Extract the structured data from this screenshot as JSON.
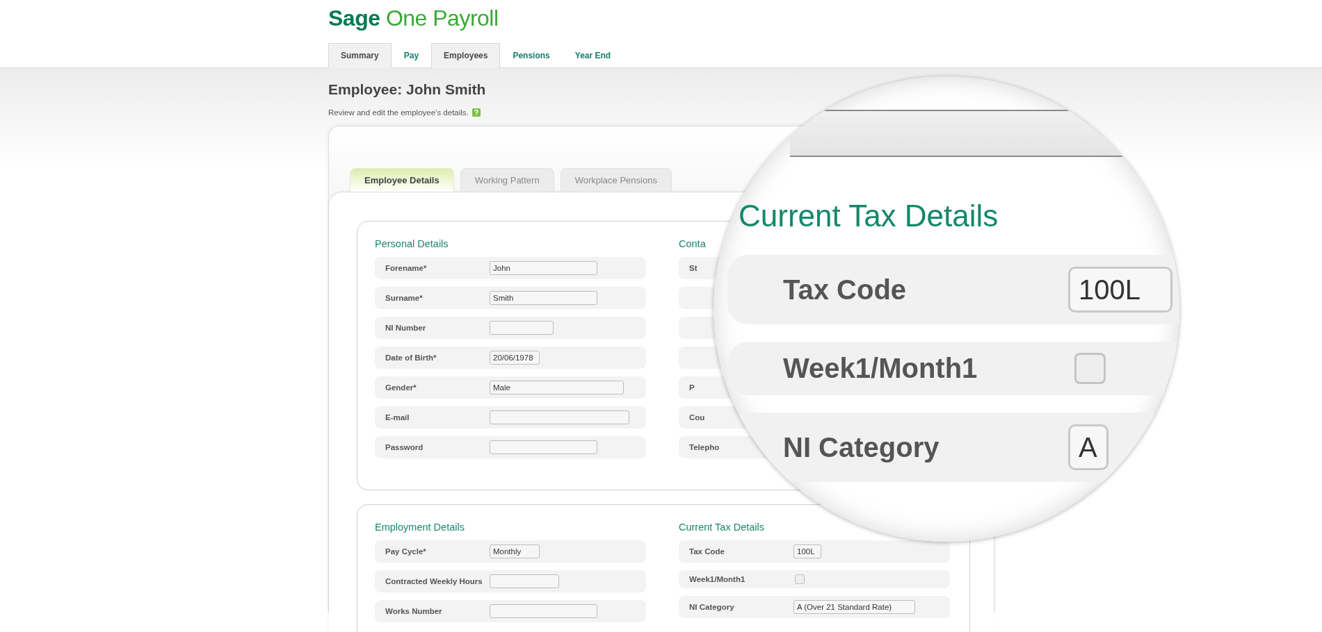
{
  "logo": {
    "brand": "Sage",
    "product": "One Payroll"
  },
  "nav": [
    {
      "label": "Summary",
      "selected": true
    },
    {
      "label": "Pay",
      "selected": false
    },
    {
      "label": "Employees",
      "selected": true
    },
    {
      "label": "Pensions",
      "selected": false
    },
    {
      "label": "Year End",
      "selected": false
    }
  ],
  "page": {
    "title": "Employee: John Smith",
    "subtitle": "Review and edit the employee’s details."
  },
  "tabs": [
    {
      "label": "Employee Details",
      "selected": true
    },
    {
      "label": "Working Pattern",
      "selected": false
    },
    {
      "label": "Workplace Pensions",
      "selected": false
    }
  ],
  "sections": [
    {
      "columns": [
        {
          "heading": "Personal Details",
          "rows": [
            {
              "kind": "text",
              "label": "Forename*",
              "value": "John"
            },
            {
              "kind": "text",
              "label": "Surname*",
              "value": "Smith"
            },
            {
              "kind": "text",
              "label": "NI Number"
            },
            {
              "kind": "text",
              "label": "Date of Birth*",
              "value": "20/06/1978"
            },
            {
              "kind": "text",
              "label": "Gender*",
              "value": "Male"
            },
            {
              "kind": "text",
              "label": "E-mail"
            },
            {
              "kind": "text",
              "label": "Password"
            }
          ]
        },
        {
          "heading": "Conta",
          "rows": [
            {
              "kind": "covered",
              "label": "St"
            },
            {
              "kind": "covered"
            },
            {
              "kind": "covered"
            },
            {
              "kind": "covered"
            },
            {
              "kind": "covered",
              "label": "P"
            },
            {
              "kind": "covered",
              "label": "Cou"
            },
            {
              "kind": "covered",
              "label": "Telepho"
            }
          ]
        }
      ]
    },
    {
      "columns": [
        {
          "heading": "Employment Details",
          "rows": [
            {
              "kind": "text",
              "label": "Pay Cycle*",
              "value": "Monthly"
            },
            {
              "kind": "text",
              "label": "Contracted Weekly Hours"
            },
            {
              "kind": "text",
              "label": "Works Number"
            }
          ]
        },
        {
          "heading": "Current Tax Details",
          "rows": [
            {
              "kind": "text",
              "label": "Tax Code",
              "value": "100L"
            },
            {
              "kind": "checkbox",
              "label": "Week1/Month1",
              "checked": false
            },
            {
              "kind": "text",
              "label": "NI Category",
              "value": "A (Over 21 Standard Rate)"
            }
          ]
        }
      ]
    }
  ],
  "magnifier": {
    "heading": "Current Tax Details",
    "rows": [
      {
        "kind": "text",
        "label": "Tax Code",
        "value": "100L"
      },
      {
        "kind": "checkbox",
        "label": "Week1/Month1",
        "checked": false
      },
      {
        "kind": "text",
        "label": "NI Category",
        "value": "A"
      }
    ]
  }
}
